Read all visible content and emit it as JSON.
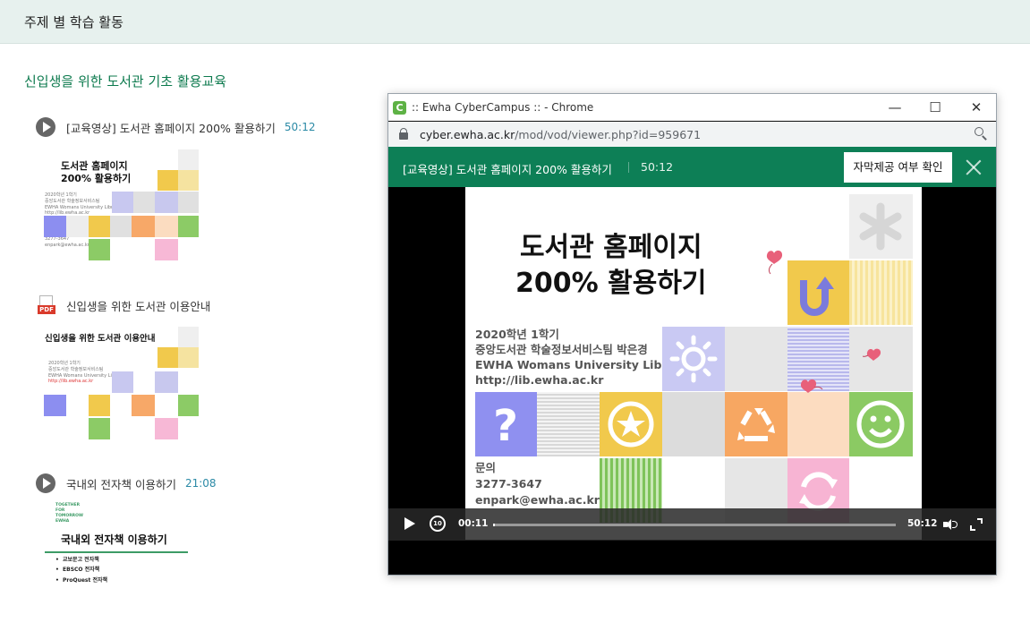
{
  "page": {
    "header_title": "주제 별 학습 활동",
    "section_title": "신입생을 위한 도서관 기초 활용교육"
  },
  "activities": [
    {
      "type": "video",
      "label": "[교육영상] 도서관 홈페이지 200% 활용하기",
      "duration": "50:12",
      "icon": "play-circle-icon"
    },
    {
      "type": "pdf",
      "label": "신입생을 위한 도서관 이용안내",
      "icon": "pdf-icon"
    },
    {
      "type": "video",
      "label": "국내외 전자책 이용하기",
      "duration": "21:08",
      "icon": "play-circle-icon"
    }
  ],
  "thumbnails": {
    "thumb1": {
      "title": "도서관 홈페이지\n200% 활용하기"
    },
    "thumb2": {
      "title": "신입생을 위한 도서관 이용안내"
    },
    "thumb3": {
      "brand": "TOGETHER FOR TOMORROW EWHA",
      "title": "국내외 전자책 이용하기",
      "items": [
        "교보문고 전자책",
        "EBSCO 전자책",
        "ProQuest 전자책"
      ]
    }
  },
  "popup": {
    "window_title": ":: Ewha CyberCampus :: - Chrome",
    "app_icon_letter": "C",
    "url_domain": "cyber.ewha.ac.kr",
    "url_path": "/mod/vod/viewer.php?id=959671",
    "minimize_label": "—",
    "maximize_label": "☐",
    "close_label": "✕",
    "vod_title": "[교육영상] 도서관 홈페이지 200% 활용하기",
    "vod_duration": "50:12",
    "caption_button": "자막제공 여부 확인",
    "slide": {
      "title_line1": "도서관 홈페이지",
      "title_line2": "200% 활용하기",
      "info_line1": "2020학년 1학기",
      "info_line2": "중앙도서관 학술정보서비스팀 박은경",
      "info_line3": "EWHA Womans University Library",
      "info_line4": "http://lib.ewha.ac.kr",
      "contact_line1": "문의",
      "contact_line2": "3277-3647",
      "contact_line3": "enpark@ewha.ac.kr"
    },
    "player": {
      "current_time": "00:11",
      "total_time": "50:12",
      "rewind_label": "10",
      "progress_fraction": 0.004
    }
  },
  "colors": {
    "accent_green": "#0d7f56",
    "section_title": "#0d7a4e",
    "duration_blue": "#2b8aa6",
    "header_bg": "#e7f1ee"
  }
}
